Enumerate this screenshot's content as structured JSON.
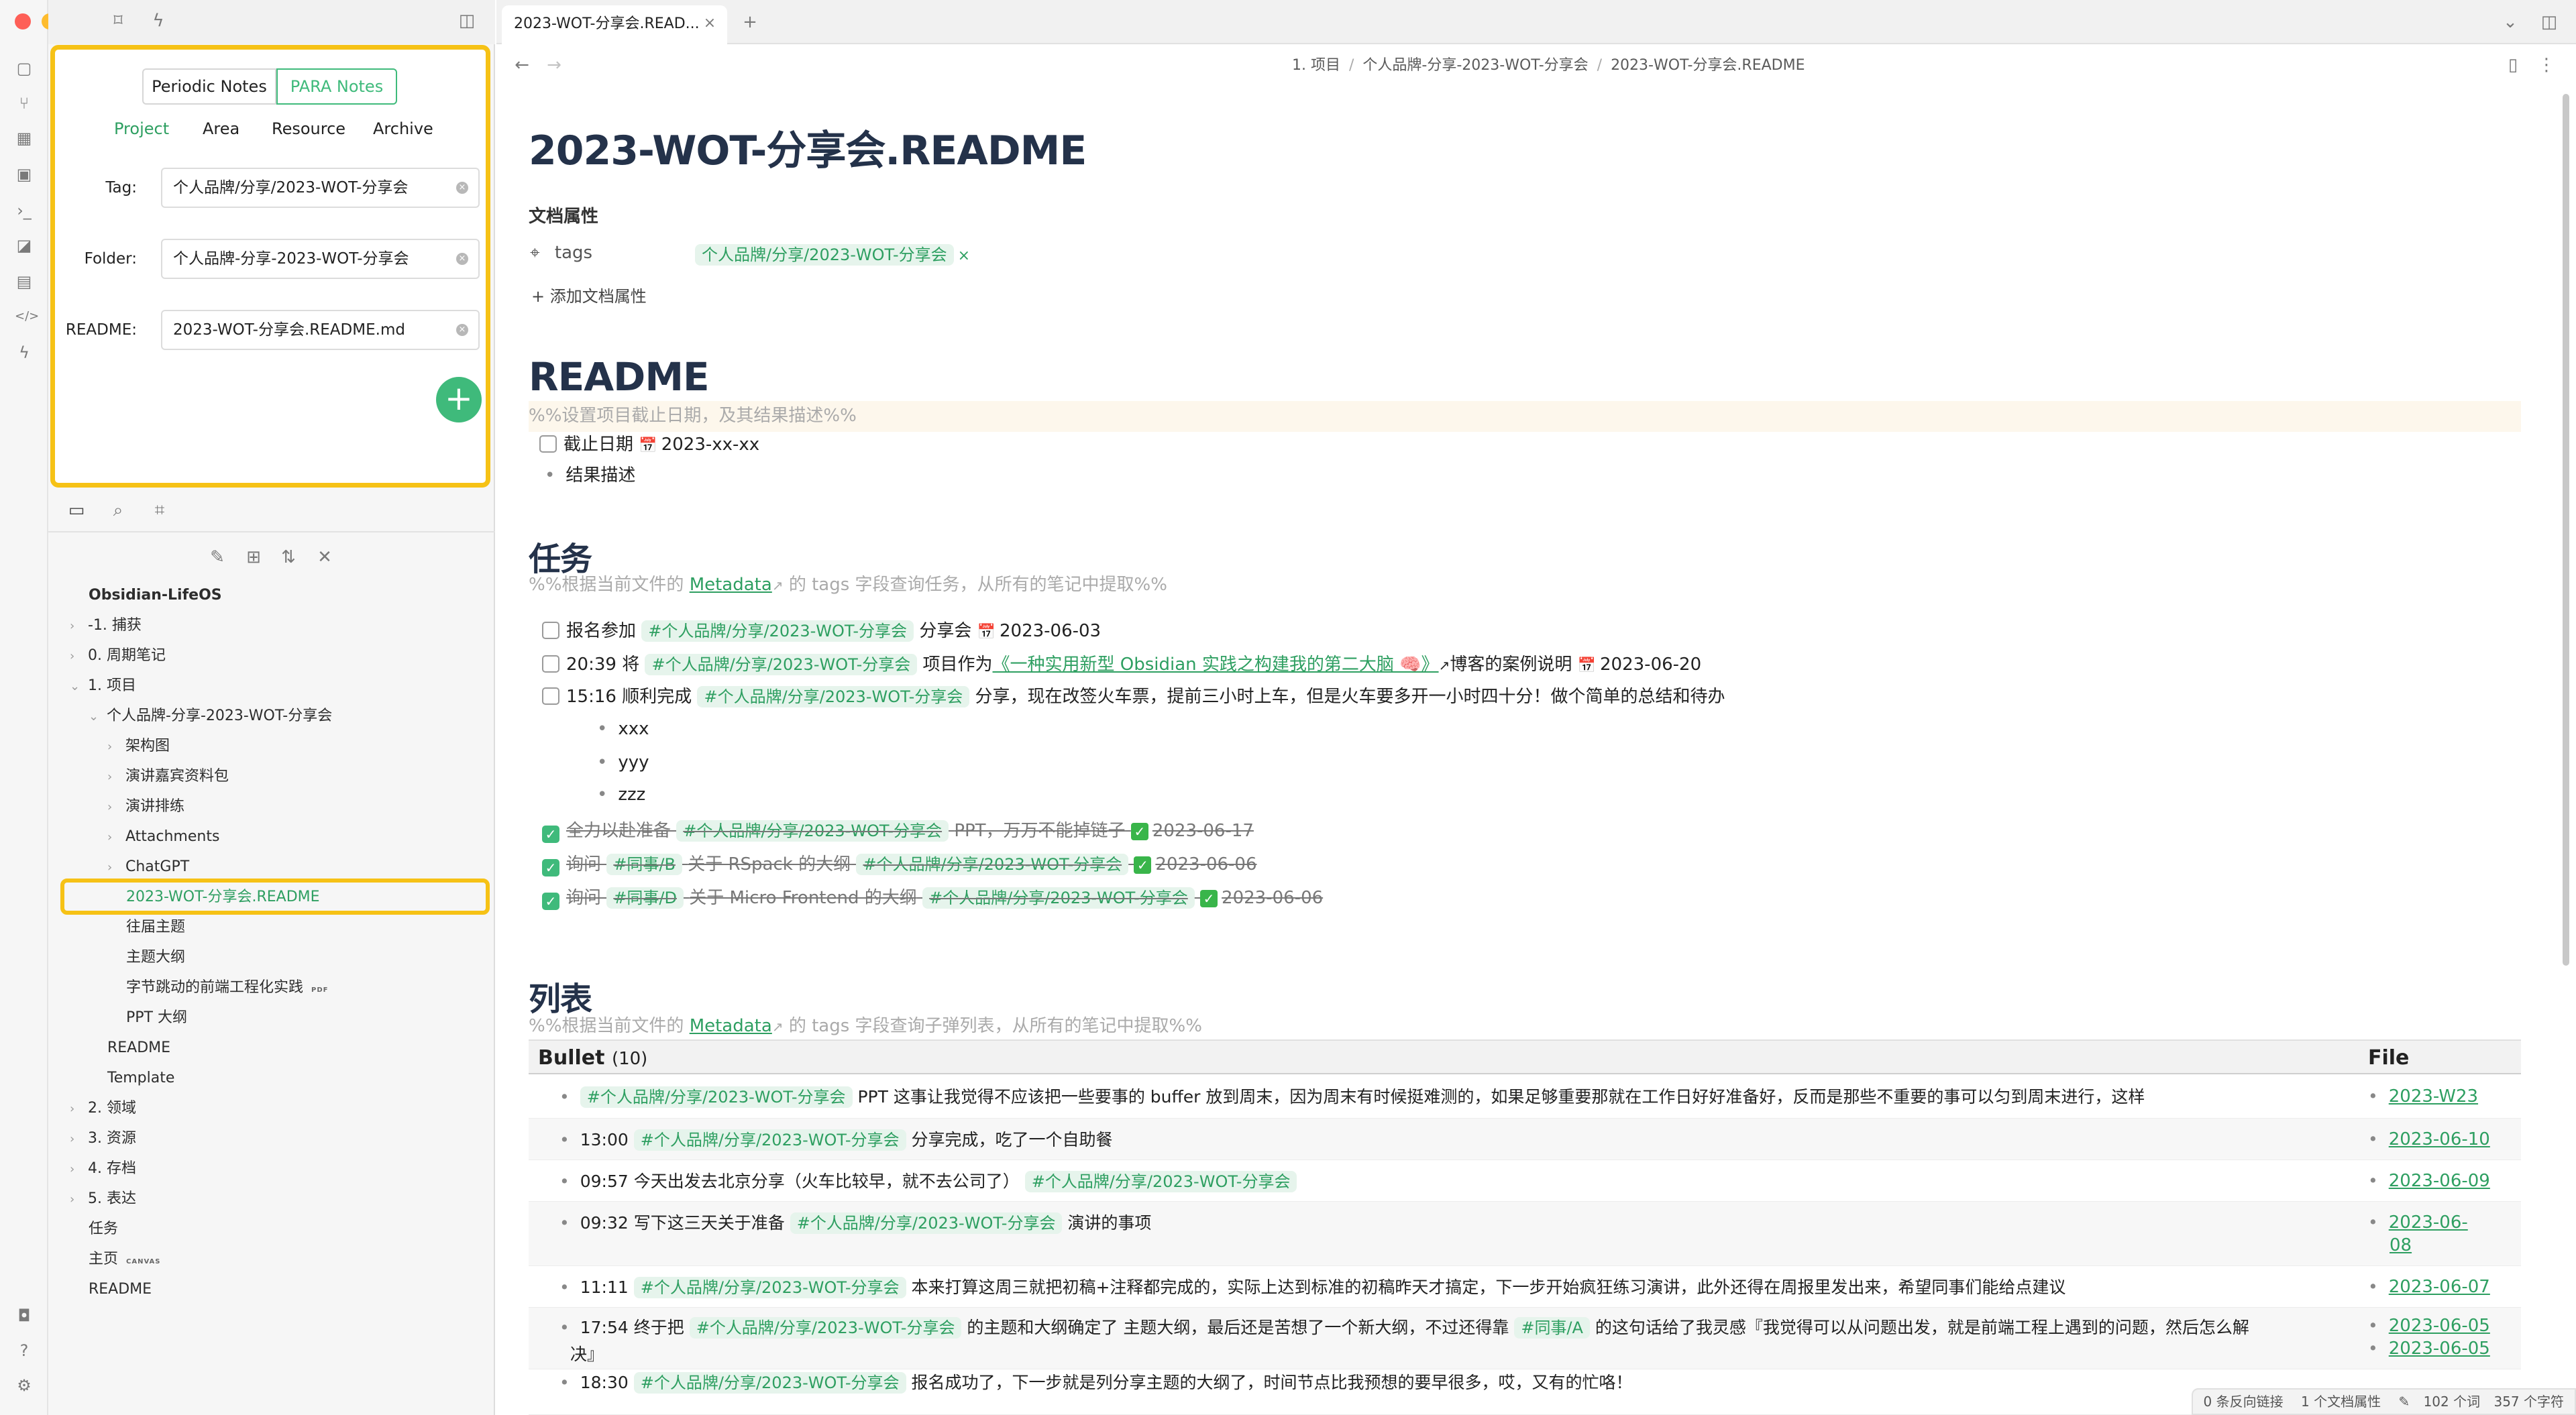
{
  "sidebar": {
    "segments": [
      "Periodic Notes",
      "PARA Notes"
    ],
    "para_tabs": [
      "Project",
      "Area",
      "Resource",
      "Archive"
    ],
    "form": {
      "tag_label": "Tag:",
      "tag_value": "个人品牌/分享/2023-WOT-分享会",
      "folder_label": "Folder:",
      "folder_value": "个人品牌-分享-2023-WOT-分享会",
      "readme_label": "README:",
      "readme_value": "2023-WOT-分享会.README.md"
    },
    "tree": {
      "root": "Obsidian-LifeOS",
      "items": [
        "-1. 捕获",
        "0. 周期笔记",
        "1. 项目",
        "个人品牌-分享-2023-WOT-分享会",
        "架构图",
        "演讲嘉宾资料包",
        "演讲排练",
        "Attachments",
        "ChatGPT",
        "2023-WOT-分享会.README",
        "往届主题",
        "主题大纲",
        "字节跳动的前端工程化实践",
        "PPT 大纲",
        "README",
        "Template",
        "2. 领域",
        "3. 资源",
        "4. 存档",
        "5. 表达",
        "任务",
        "主页",
        "README"
      ],
      "badges": {
        "pdf": "PDF",
        "canvas": "CANVAS"
      }
    }
  },
  "tabbar": {
    "active_tab": "2023-WOT-分享会.READ..."
  },
  "breadcrumb": [
    "1. 项目",
    "个人品牌-分享-2023-WOT-分享会",
    "2023-WOT-分享会.README"
  ],
  "doc": {
    "title": "2023-WOT-分享会.README",
    "properties_heading": "文档属性",
    "prop_key": "tags",
    "prop_tag": "个人品牌/分享/2023-WOT-分享会",
    "add_prop": "添加文档属性",
    "readme_heading": "README",
    "readme_comment": "%%设置项目截止日期，及其结果描述%%",
    "deadline": "截止日期",
    "deadline_date": "2023-xx-xx",
    "result": "结果描述",
    "tasks_heading": "任务",
    "tasks_comment_a": "%%根据当前文件的",
    "tasks_comment_link": "Metadata",
    "tasks_comment_b": "的 tags 字段查询任务，从所有的笔记中提取%%",
    "tag": "#个人品牌/分享/2023-WOT-分享会",
    "t1_a": "报名参加",
    "t1_b": "分享会",
    "t1_date": "2023-06-03",
    "t2_a": "20:39 将",
    "t2_b": "项目作为",
    "t2_link": "《一种实用新型 Obsidian 实践之构建我的第二大脑 🧠》",
    "t2_c": "博客的案例说明",
    "t2_date": "2023-06-20",
    "t3_a": "15:16 顺利完成",
    "t3_b": "分享，现在改签火车票，提前三小时上车，但是火车要多开一小时四十分！做个简单的总结和待办",
    "sub": [
      "xxx",
      "yyy",
      "zzz"
    ],
    "d1_a": "全力以赴准备",
    "d1_b": "PPT，万万不能掉链子",
    "d1_date": "2023-06-17",
    "d2_a": "询问",
    "d2_tag": "#同事/B",
    "d2_b": "关于 RSpack 的大纲",
    "d2_date": "2023-06-06",
    "d3_a": "询问",
    "d3_tag": "#同事/D",
    "d3_b": "关于 Micro Frontend 的大纲",
    "d3_date": "2023-06-06",
    "list_heading": "列表",
    "list_comment_b": "的 tags 字段查询子弹列表，从所有的笔记中提取%%",
    "table": {
      "col_bullet": "Bullet",
      "count": "(10)",
      "col_file": "File",
      "rows": [
        {
          "pre": "",
          "post": "PPT 这事让我觉得不应该把一些要事的 buffer 放到周末，因为周末有时候挺难测的，如果足够重要那就在工作日好好准备好，反而是那些不重要的事可以匀到周末进行，这样",
          "file": "2023-W23"
        },
        {
          "pre": "13:00",
          "post": "分享完成，吃了一个自助餐",
          "file": "2023-06-10"
        },
        {
          "pre": "09:57 今天出发去北京分享（火车比较早，就不去公司了）",
          "post": "",
          "file": "2023-06-09"
        },
        {
          "pre": "09:32 写下这三天关于准备",
          "post": "演讲的事项",
          "file": "2023-06-",
          "file2": "08"
        },
        {
          "pre": "11:11",
          "post": "本来打算这周三就把初稿+注释都完成的，实际上达到标准的初稿昨天才搞定，下一步开始疯狂练习演讲，此外还得在周报里发出来，希望同事们能给点建议",
          "file": "2023-06-07"
        },
        {
          "pre": "17:54 终于把",
          "post": "的主题和大纲确定了 主题大纲，最后还是苦想了一个新大纲，不过还得靠",
          "tag2": "#同事/A",
          "post2": "的这句话给了我灵感『我觉得可以从问题出发，就是前端工程上遇到的问题，然后怎么解",
          "post3": "决』",
          "file": "2023-06-05",
          "file2": "2023-06-05"
        },
        {
          "pre": "18:30",
          "post": "报名成功了，下一步就是列分享主题的大纲了，时间节点比我预想的要早很多，哎，又有的忙咯！",
          "file": ""
        }
      ]
    }
  },
  "status": {
    "backlinks": "0 条反向链接",
    "props": "1 个文档属性",
    "words": "102 个词",
    "chars": "357 个字符"
  },
  "colors": {
    "accent": "#3fba7b",
    "highlight": "#f6c216",
    "heading": "#24324a"
  }
}
